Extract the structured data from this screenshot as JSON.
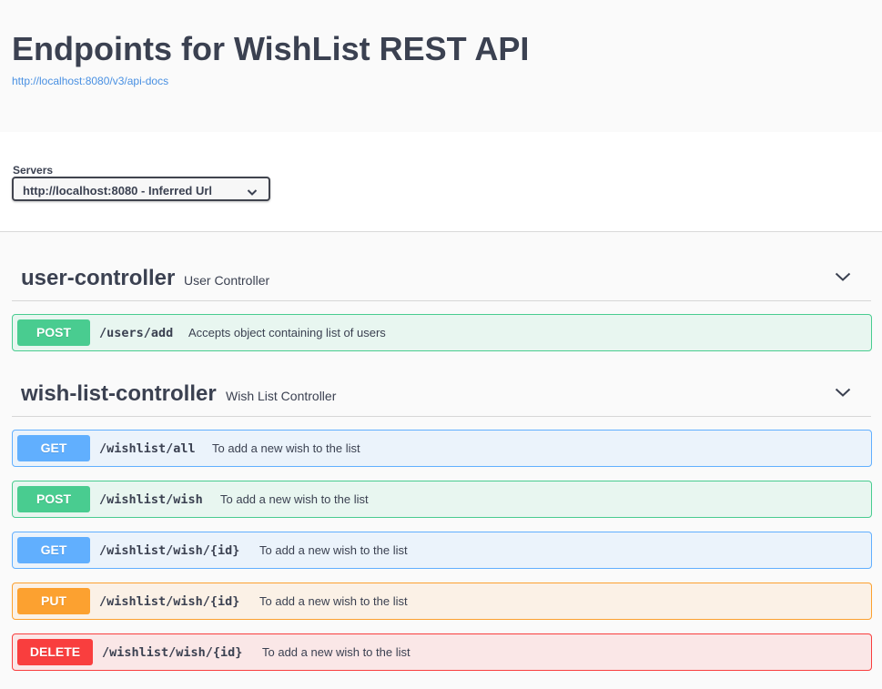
{
  "info": {
    "title": "Endpoints for WishList REST API",
    "link": "http://localhost:8080/v3/api-docs"
  },
  "servers": {
    "label": "Servers",
    "selected": "http://localhost:8080 - Inferred Url"
  },
  "tags": [
    {
      "name": "user-controller",
      "description": "User Controller",
      "operations": [
        {
          "method": "POST",
          "path": "/users/add",
          "summary": "Accepts object containing list of users"
        }
      ]
    },
    {
      "name": "wish-list-controller",
      "description": "Wish List Controller",
      "operations": [
        {
          "method": "GET",
          "path": "/wishlist/all",
          "summary": "To add a new wish to the list"
        },
        {
          "method": "POST",
          "path": "/wishlist/wish",
          "summary": "To add a new wish to the list"
        },
        {
          "method": "GET",
          "path": "/wishlist/wish/{id}",
          "summary": "To add a new wish to the list"
        },
        {
          "method": "PUT",
          "path": "/wishlist/wish/{id}",
          "summary": "To add a new wish to the list"
        },
        {
          "method": "DELETE",
          "path": "/wishlist/wish/{id}",
          "summary": "To add a new wish to the list"
        }
      ]
    }
  ],
  "colors": {
    "post": "#49cc90",
    "get": "#61affe",
    "put": "#fca130",
    "delete": "#f93e3e"
  }
}
